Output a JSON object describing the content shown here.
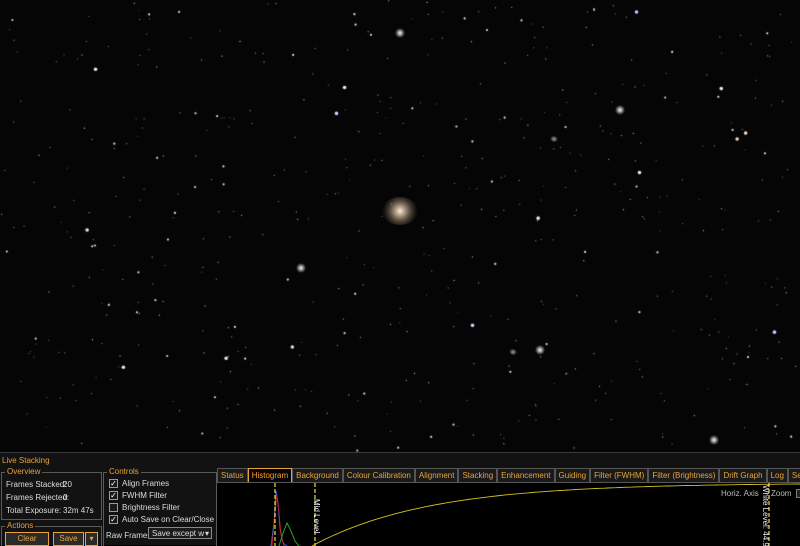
{
  "app": {
    "panel_title": "Live Stacking"
  },
  "overview": {
    "legend": "Overview",
    "frames_stacked_label": "Frames Stacked:",
    "frames_stacked_value": "20",
    "frames_rejected_label": "Frames Rejected:",
    "frames_rejected_value": "0",
    "total_exposure_label": "Total Exposure:",
    "total_exposure_value": "32m 47s"
  },
  "actions": {
    "legend": "Actions",
    "clear_label": "Clear",
    "save_label": "Save",
    "save_menu_icon": "chevron-down-icon"
  },
  "controls": {
    "legend": "Controls",
    "items": [
      {
        "label": "Align Frames",
        "checked": true
      },
      {
        "label": "FWHM Filter",
        "checked": true
      },
      {
        "label": "Brightness Filter",
        "checked": false
      },
      {
        "label": "Auto Save on Clear/Close",
        "checked": true
      }
    ],
    "raw_frames_label": "Raw Frames",
    "raw_frames_value": "Save except w",
    "raw_frames_icon": "chevron-down-icon"
  },
  "tabs": [
    {
      "label": "Status",
      "active": false
    },
    {
      "label": "Histogram",
      "active": true
    },
    {
      "label": "Background",
      "active": false
    },
    {
      "label": "Colour Calibration",
      "active": false
    },
    {
      "label": "Alignment",
      "active": false
    },
    {
      "label": "Stacking",
      "active": false
    },
    {
      "label": "Enhancement",
      "active": false
    },
    {
      "label": "Guiding",
      "active": false
    },
    {
      "label": "Filter (FWHM)",
      "active": false
    },
    {
      "label": "Filter (Brightness)",
      "active": false
    },
    {
      "label": "Drift Graph",
      "active": false
    },
    {
      "label": "Log",
      "active": false
    },
    {
      "label": "Settings",
      "active": false
    }
  ],
  "histogram": {
    "horiz_axis_label": "Horiz. Axis",
    "zoom_label": "Zoom",
    "mid_level_label": "Mid Level",
    "white_level_label": "White Level: 44.99",
    "colors": {
      "curve": "#d4c21a",
      "marker": "#f0e040",
      "red": "#d02020",
      "green": "#30a030",
      "blue": "#3060e0"
    }
  },
  "colors": {
    "accent": "#e8a33a",
    "panel_bg": "#121212"
  }
}
